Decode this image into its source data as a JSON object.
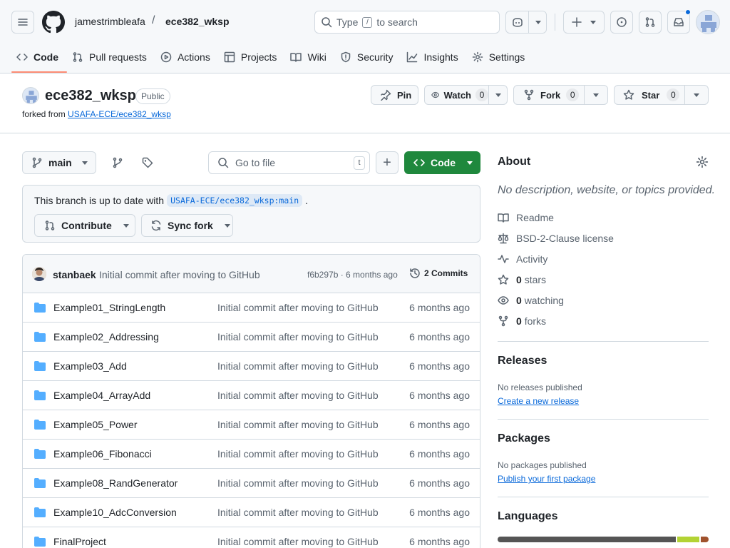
{
  "header": {
    "owner": "jamestrimbleafa",
    "separator": "/",
    "repo": "ece382_wksp",
    "search_placeholder_pre": "Type",
    "search_key": "/",
    "search_placeholder_post": "to search"
  },
  "tabs": [
    {
      "label": "Code",
      "icon": "code-icon"
    },
    {
      "label": "Pull requests",
      "icon": "pull-request-icon"
    },
    {
      "label": "Actions",
      "icon": "play-icon"
    },
    {
      "label": "Projects",
      "icon": "table-icon"
    },
    {
      "label": "Wiki",
      "icon": "book-icon"
    },
    {
      "label": "Security",
      "icon": "shield-icon"
    },
    {
      "label": "Insights",
      "icon": "graph-icon"
    },
    {
      "label": "Settings",
      "icon": "gear-icon"
    }
  ],
  "repo": {
    "name": "ece382_wksp",
    "visibility": "Public",
    "forked_from_label": "forked from",
    "forked_from": "USAFA-ECE/ece382_wksp",
    "pin": "Pin",
    "watch": "Watch",
    "watch_count": "0",
    "fork": "Fork",
    "fork_count": "0",
    "star": "Star",
    "star_count": "0"
  },
  "toolbar": {
    "branch": "main",
    "go_to_file": "Go to file",
    "go_to_file_key": "t",
    "add": "+",
    "code_button": "Code"
  },
  "sync": {
    "text": "This branch is up to date with",
    "ref": "USAFA-ECE/ece382_wksp:main",
    "period": ".",
    "contribute": "Contribute",
    "sync_fork": "Sync fork"
  },
  "commit": {
    "author": "stanbaek",
    "message": "Initial commit after moving to GitHub",
    "sha_age": "f6b297b · 6 months ago",
    "commits": "2 Commits"
  },
  "files": [
    {
      "name": "Example01_StringLength",
      "message": "Initial commit after moving to GitHub",
      "age": "6 months ago"
    },
    {
      "name": "Example02_Addressing",
      "message": "Initial commit after moving to GitHub",
      "age": "6 months ago"
    },
    {
      "name": "Example03_Add",
      "message": "Initial commit after moving to GitHub",
      "age": "6 months ago"
    },
    {
      "name": "Example04_ArrayAdd",
      "message": "Initial commit after moving to GitHub",
      "age": "6 months ago"
    },
    {
      "name": "Example05_Power",
      "message": "Initial commit after moving to GitHub",
      "age": "6 months ago"
    },
    {
      "name": "Example06_Fibonacci",
      "message": "Initial commit after moving to GitHub",
      "age": "6 months ago"
    },
    {
      "name": "Example08_RandGenerator",
      "message": "Initial commit after moving to GitHub",
      "age": "6 months ago"
    },
    {
      "name": "Example10_AdcConversion",
      "message": "Initial commit after moving to GitHub",
      "age": "6 months ago"
    },
    {
      "name": "FinalProject",
      "message": "Initial commit after moving to GitHub",
      "age": "6 months ago"
    }
  ],
  "about": {
    "title": "About",
    "description": "No description, website, or topics provided.",
    "readme": "Readme",
    "license": "BSD-2-Clause license",
    "activity": "Activity",
    "stars_count": "0",
    "stars_label": "stars",
    "watching_count": "0",
    "watching_label": "watching",
    "forks_count": "0",
    "forks_label": "forks"
  },
  "releases": {
    "title": "Releases",
    "empty": "No releases published",
    "link": "Create a new release"
  },
  "packages": {
    "title": "Packages",
    "empty": "No packages published",
    "link": "Publish your first package"
  },
  "languages": {
    "title": "Languages",
    "bar_colors": [
      "#555555",
      "#b3d334",
      "#a0522d"
    ]
  },
  "colors": {
    "accent": "#0969da",
    "primary_button": "#1f883d",
    "tab_underline": "#fd8c73",
    "folder": "#54aeff"
  }
}
